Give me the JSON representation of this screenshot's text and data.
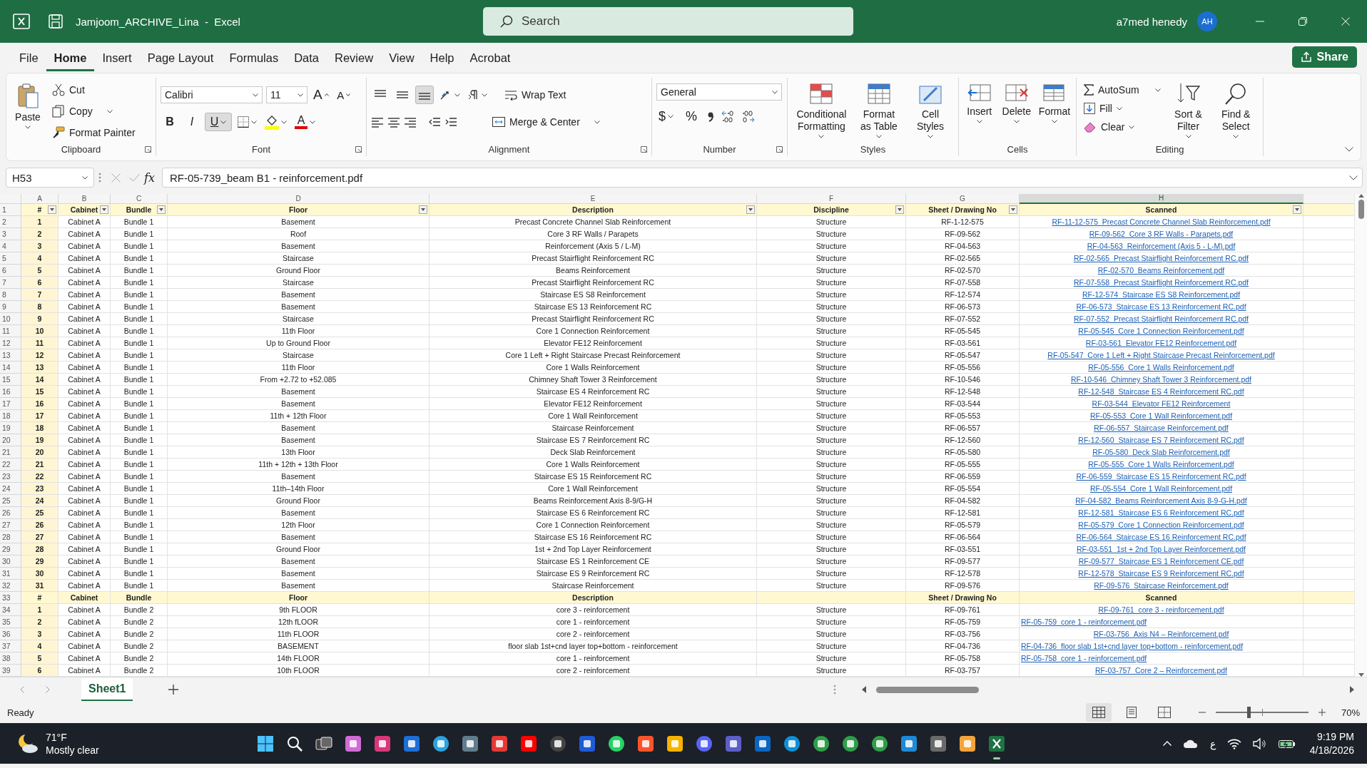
{
  "window": {
    "title": "Jamjoom_ARCHIVE_Lina  -  Excel"
  },
  "search": {
    "placeholder": "Search"
  },
  "account": {
    "name": "a7med henedy",
    "initials": "AH"
  },
  "menu_tabs": [
    {
      "label": "File",
      "selected": false
    },
    {
      "label": "Home",
      "selected": true
    },
    {
      "label": "Insert",
      "selected": false
    },
    {
      "label": "Page Layout",
      "selected": false
    },
    {
      "label": "Formulas",
      "selected": false
    },
    {
      "label": "Data",
      "selected": false
    },
    {
      "label": "Review",
      "selected": false
    },
    {
      "label": "View",
      "selected": false
    },
    {
      "label": "Help",
      "selected": false
    },
    {
      "label": "Acrobat",
      "selected": false
    }
  ],
  "share_button": "Share",
  "ribbon": {
    "clipboard": {
      "label": "Clipboard",
      "paste": "Paste",
      "cut": "Cut",
      "copy": "Copy",
      "format_painter": "Format Painter"
    },
    "font": {
      "label": "Font",
      "name": "Calibri",
      "size": "11",
      "grow": "A",
      "shrink": "A",
      "styles": [
        {
          "label": "B",
          "pressed": false
        },
        {
          "label": "I",
          "pressed": false
        },
        {
          "label": "U",
          "pressed": true
        }
      ],
      "font_color": "A"
    },
    "alignment": {
      "label": "Alignment",
      "vertical": [
        {
          "selected": false
        },
        {
          "selected": false
        },
        {
          "selected": true
        }
      ],
      "wrap_text": "Wrap Text",
      "merge": "Merge & Center"
    },
    "number": {
      "label": "Number",
      "format": "General",
      "currency": "$",
      "percent": "%"
    },
    "styles": {
      "label": "Styles",
      "buttons": [
        "Conditional Formatting",
        "Format as Table",
        "Cell Styles"
      ]
    },
    "cells": {
      "label": "Cells",
      "buttons": [
        "Insert",
        "Delete",
        "Format"
      ]
    },
    "editing": {
      "label": "Editing",
      "autosum": "AutoSum",
      "fill": "Fill",
      "clear": "Clear",
      "buttons": [
        "Sort & Filter",
        "Find & Select"
      ]
    }
  },
  "formula_bar": {
    "name_box": "H53",
    "fx": "fx",
    "formula": "RF-05-739_beam B1 - reinforcement.pdf"
  },
  "sheet": {
    "columns": [
      {
        "label": "A",
        "selected": false
      },
      {
        "label": "B",
        "selected": false
      },
      {
        "label": "C",
        "selected": false
      },
      {
        "label": "D",
        "selected": false
      },
      {
        "label": "E",
        "selected": false
      },
      {
        "label": "F",
        "selected": false
      },
      {
        "label": "G",
        "selected": false
      },
      {
        "label": "H",
        "selected": true
      }
    ],
    "rows": [
      {
        "row": "1",
        "kind": "header",
        "filters": true,
        "cells": [
          "#",
          "Cabinet",
          "Bundle",
          "Floor",
          "Description",
          "Discipline",
          "Sheet / Drawing No",
          "Scanned"
        ]
      },
      {
        "row": "2",
        "kind": "data",
        "cells": [
          "1",
          "Cabinet A",
          "Bundle 1",
          "Basement",
          "Precast Concrete Channel Slab Reinforcement",
          "Structure",
          "RF-1-12-575",
          "RF-11-12-575_Precast Concrete Channel Slab Reinforcement.pdf"
        ]
      },
      {
        "row": "3",
        "kind": "data",
        "cells": [
          "2",
          "Cabinet A",
          "Bundle 1",
          "Roof",
          "Core 3 RF Walls / Parapets",
          "Structure",
          "RF-09-562",
          "RF-09-562_Core 3 RF Walls - Parapets.pdf"
        ]
      },
      {
        "row": "4",
        "kind": "data",
        "cells": [
          "3",
          "Cabinet A",
          "Bundle 1",
          "Basement",
          "Reinforcement (Axis 5 / L-M)",
          "Structure",
          "RF-04-563",
          "RF-04-563_Reinforcement (Axis 5 - L-M).pdf"
        ]
      },
      {
        "row": "5",
        "kind": "data",
        "cells": [
          "4",
          "Cabinet A",
          "Bundle 1",
          "Staircase",
          "Precast Stairflight Reinforcement RC",
          "Structure",
          "RF-02-565",
          "RF-02-565_Precast Stairflight Reinforcement RC.pdf"
        ]
      },
      {
        "row": "6",
        "kind": "data",
        "cells": [
          "5",
          "Cabinet A",
          "Bundle 1",
          "Ground Floor",
          "Beams Reinforcement",
          "Structure",
          "RF-02-570",
          "RF-02-570_Beams Reinforcement.pdf"
        ]
      },
      {
        "row": "7",
        "kind": "data",
        "cells": [
          "6",
          "Cabinet A",
          "Bundle 1",
          "Staircase",
          "Precast Stairflight Reinforcement RC",
          "Structure",
          "RF-07-558",
          "RF-07-558_Precast Stairflight Reinforcement RC.pdf"
        ]
      },
      {
        "row": "8",
        "kind": "data",
        "cells": [
          "7",
          "Cabinet A",
          "Bundle 1",
          "Basement",
          "Staircase ES S8 Reinforcement",
          "Structure",
          "RF-12-574",
          "RF-12-574_Staircase ES S8 Reinforcement.pdf"
        ]
      },
      {
        "row": "9",
        "kind": "data",
        "cells": [
          "8",
          "Cabinet A",
          "Bundle 1",
          "Basement",
          "Staircase ES 13 Reinforcement RC",
          "Structure",
          "RF-06-573",
          "RF-06-573_Staircase ES 13 Reinforcement RC.pdf"
        ]
      },
      {
        "row": "10",
        "kind": "data",
        "cells": [
          "9",
          "Cabinet A",
          "Bundle 1",
          "Staircase",
          "Precast Stairflight Reinforcement RC",
          "Structure",
          "RF-07-552",
          "RF-07-552_Precast Stairflight Reinforcement RC.pdf"
        ]
      },
      {
        "row": "11",
        "kind": "data",
        "cells": [
          "10",
          "Cabinet A",
          "Bundle 1",
          "11th Floor",
          "Core 1 Connection Reinforcement",
          "Structure",
          "RF-05-545",
          "RF-05-545_Core 1 Connection Reinforcement.pdf"
        ]
      },
      {
        "row": "12",
        "kind": "data",
        "cells": [
          "11",
          "Cabinet A",
          "Bundle 1",
          "Up to Ground Floor",
          "Elevator FE12 Reinforcement",
          "Structure",
          "RF-03-561",
          "RF-03-561_Elevator FE12 Reinforcement.pdf"
        ]
      },
      {
        "row": "13",
        "kind": "data",
        "cells": [
          "12",
          "Cabinet A",
          "Bundle 1",
          "Staircase",
          "Core 1 Left + Right Staircase Precast Reinforcement",
          "Structure",
          "RF-05-547",
          "RF-05-547_Core 1 Left + Right Staircase Precast Reinforcement.pdf"
        ]
      },
      {
        "row": "14",
        "kind": "data",
        "cells": [
          "13",
          "Cabinet A",
          "Bundle 1",
          "11th Floor",
          "Core 1 Walls Reinforcement",
          "Structure",
          "RF-05-556",
          "RF-05-556_Core 1 Walls Reinforcement.pdf"
        ]
      },
      {
        "row": "15",
        "kind": "data",
        "cells": [
          "14",
          "Cabinet A",
          "Bundle 1",
          "From +2.72 to +52.085",
          "Chimney Shaft Tower 3 Reinforcement",
          "Structure",
          "RF-10-546",
          "RF-10-546_Chimney Shaft Tower 3 Reinforcement.pdf"
        ]
      },
      {
        "row": "16",
        "kind": "data",
        "cells": [
          "15",
          "Cabinet A",
          "Bundle 1",
          "Basement",
          "Staircase ES 4 Reinforcement RC",
          "Structure",
          "RF-12-548",
          "RF-12-548_Staircase ES 4 Reinforcement RC.pdf"
        ]
      },
      {
        "row": "17",
        "kind": "data",
        "cells": [
          "16",
          "Cabinet A",
          "Bundle 1",
          "Basement",
          "Elevator FE12 Reinforcement",
          "Structure",
          "RF-03-544",
          "RF-03-544_Elevator FE12 Reinforcement"
        ]
      },
      {
        "row": "18",
        "kind": "data",
        "cells": [
          "17",
          "Cabinet A",
          "Bundle 1",
          "11th + 12th Floor",
          "Core 1 Wall Reinforcement",
          "Structure",
          "RF-05-553",
          "RF-05-553_Core 1 Wall Reinforcement.pdf"
        ]
      },
      {
        "row": "19",
        "kind": "data",
        "cells": [
          "18",
          "Cabinet A",
          "Bundle 1",
          "Basement",
          "Staircase Reinforcement",
          "Structure",
          "RF-06-557",
          "RF-06-557_Staircase Reinforcement.pdf"
        ]
      },
      {
        "row": "20",
        "kind": "data",
        "cells": [
          "19",
          "Cabinet A",
          "Bundle 1",
          "Basement",
          "Staircase ES 7 Reinforcement RC",
          "Structure",
          "RF-12-560",
          "RF-12-560_Staircase ES 7 Reinforcement RC.pdf"
        ]
      },
      {
        "row": "21",
        "kind": "data",
        "cells": [
          "20",
          "Cabinet A",
          "Bundle 1",
          "13th Floor",
          "Deck Slab Reinforcement",
          "Structure",
          "RF-05-580",
          "RF-05-580_Deck Slab Reinforcement.pdf"
        ]
      },
      {
        "row": "22",
        "kind": "data",
        "cells": [
          "21",
          "Cabinet A",
          "Bundle 1",
          "11th + 12th + 13th Floor",
          "Core 1 Walls Reinforcement",
          "Structure",
          "RF-05-555",
          "RF-05-555_Core 1 Walls Reinforcement.pdf"
        ]
      },
      {
        "row": "23",
        "kind": "data",
        "cells": [
          "22",
          "Cabinet A",
          "Bundle 1",
          "Basement",
          "Staircase ES 15 Reinforcement RC",
          "Structure",
          "RF-06-559",
          "RF-06-559_Staircase ES 15 Reinforcement RC.pdf"
        ]
      },
      {
        "row": "24",
        "kind": "data",
        "cells": [
          "23",
          "Cabinet A",
          "Bundle 1",
          "11th–14th Floor",
          "Core 1 Wall Reinforcement",
          "Structure",
          "RF-05-554",
          "RF-05-554_Core 1 Wall Reinforcement.pdf"
        ]
      },
      {
        "row": "25",
        "kind": "data",
        "cells": [
          "24",
          "Cabinet A",
          "Bundle 1",
          "Ground Floor",
          "Beams Reinforcement Axis 8-9/G-H",
          "Structure",
          "RF-04-582",
          "RF-04-582_Beams Reinforcement Axis 8-9-G-H.pdf"
        ]
      },
      {
        "row": "26",
        "kind": "data",
        "cells": [
          "25",
          "Cabinet A",
          "Bundle 1",
          "Basement",
          "Staircase ES 6 Reinforcement RC",
          "Structure",
          "RF-12-581",
          "RF-12-581_Staircase ES 6 Reinforcement RC.pdf"
        ]
      },
      {
        "row": "27",
        "kind": "data",
        "cells": [
          "26",
          "Cabinet A",
          "Bundle 1",
          "12th Floor",
          "Core 1 Connection Reinforcement",
          "Structure",
          "RF-05-579",
          "RF-05-579_Core 1 Connection Reinforcement.pdf"
        ]
      },
      {
        "row": "28",
        "kind": "data",
        "cells": [
          "27",
          "Cabinet A",
          "Bundle 1",
          "Basement",
          "Staircase ES 16 Reinforcement RC",
          "Structure",
          "RF-06-564",
          "RF-06-564_Staircase ES 16 Reinforcement RC.pdf"
        ]
      },
      {
        "row": "29",
        "kind": "data",
        "cells": [
          "28",
          "Cabinet A",
          "Bundle 1",
          "Ground Floor",
          "1st + 2nd Top Layer Reinforcement",
          "Structure",
          "RF-03-551",
          "RF-03-551_1st + 2nd Top Layer Reinforcement.pdf"
        ]
      },
      {
        "row": "30",
        "kind": "data",
        "cells": [
          "29",
          "Cabinet A",
          "Bundle 1",
          "Basement",
          "Staircase ES 1 Reinforcement CE",
          "Structure",
          "RF-09-577",
          "RF-09-577_Staircase ES 1 Reinforcement CE.pdf"
        ]
      },
      {
        "row": "31",
        "kind": "data",
        "cells": [
          "30",
          "Cabinet A",
          "Bundle 1",
          "Basement",
          "Staircase ES 9 Reinforcement RC",
          "Structure",
          "RF-12-578",
          "RF-12-578_Staircase ES 9 Reinforcement RC.pdf"
        ]
      },
      {
        "row": "32",
        "kind": "data",
        "cells": [
          "31",
          "Cabinet A",
          "Bundle 1",
          "Basement",
          "Staircase Reinforcement",
          "Structure",
          "RF-09-576",
          "RF-09-576_Staircase Reinforcement.pdf"
        ]
      },
      {
        "row": "33",
        "kind": "header",
        "filters": false,
        "cells": [
          "#",
          "Cabinet",
          "Bundle",
          "Floor",
          "Description",
          null,
          "Sheet / Drawing No",
          "Scanned"
        ]
      },
      {
        "row": "34",
        "kind": "data",
        "cells": [
          "1",
          "Cabinet A",
          "Bundle 2",
          "9th FLOOR",
          "core 3 - reinforcement",
          "Structure",
          "RF-09-761",
          "RF-09-761_core 3 - reinforcement.pdf"
        ]
      },
      {
        "row": "35",
        "kind": "data",
        "left_aligned": true,
        "cells": [
          "2",
          "Cabinet A",
          "Bundle 2",
          "12th fLOOR",
          "core 1 - reinforcement",
          "Structure",
          "RF-05-759",
          "RF-05-759_core 1 - reinforcement.pdf"
        ]
      },
      {
        "row": "36",
        "kind": "data",
        "cells": [
          "3",
          "Cabinet A",
          "Bundle 2",
          "11th FLOOR",
          "core 2 - reinforcement",
          "Structure",
          "RF-03-756",
          "RF-03-756_Axis N4 – Reinforcement.pdf"
        ]
      },
      {
        "row": "37",
        "kind": "data",
        "left_aligned": true,
        "cells": [
          "4",
          "Cabinet A",
          "Bundle 2",
          "BASEMENT",
          "floor slab 1st+cnd layer top+bottom - reinforcement",
          "Structure",
          "RF-04-736",
          "RF-04-736_floor slab 1st+cnd layer top+bottom - reinforcement.pdf"
        ]
      },
      {
        "row": "38",
        "kind": "data",
        "left_aligned": true,
        "cells": [
          "5",
          "Cabinet A",
          "Bundle 2",
          "14th FLOOR",
          "core 1 - reinforcement",
          "Structure",
          "RF-05-758",
          "RF-05-758_core 1 - reinforcement.pdf"
        ]
      },
      {
        "row": "39",
        "kind": "data",
        "cells": [
          "6",
          "Cabinet A",
          "Bundle 2",
          "10th FLOOR",
          "core 2 - reinforcement",
          "Structure",
          "RF-03-757",
          "RF-03-757_Core 2 – Reinforcement.pdf"
        ]
      }
    ]
  },
  "sheet_tabs": [
    {
      "label": "Sheet1",
      "selected": true
    }
  ],
  "status_bar": {
    "status": "Ready",
    "zoom_slider": {
      "level": 0.36
    },
    "zoom": "70%"
  },
  "taskbar": {
    "temperature": "71°F",
    "weather": "Mostly clear",
    "input_language": "ع",
    "time": "9:19 PM",
    "date": "4/18/2026"
  }
}
